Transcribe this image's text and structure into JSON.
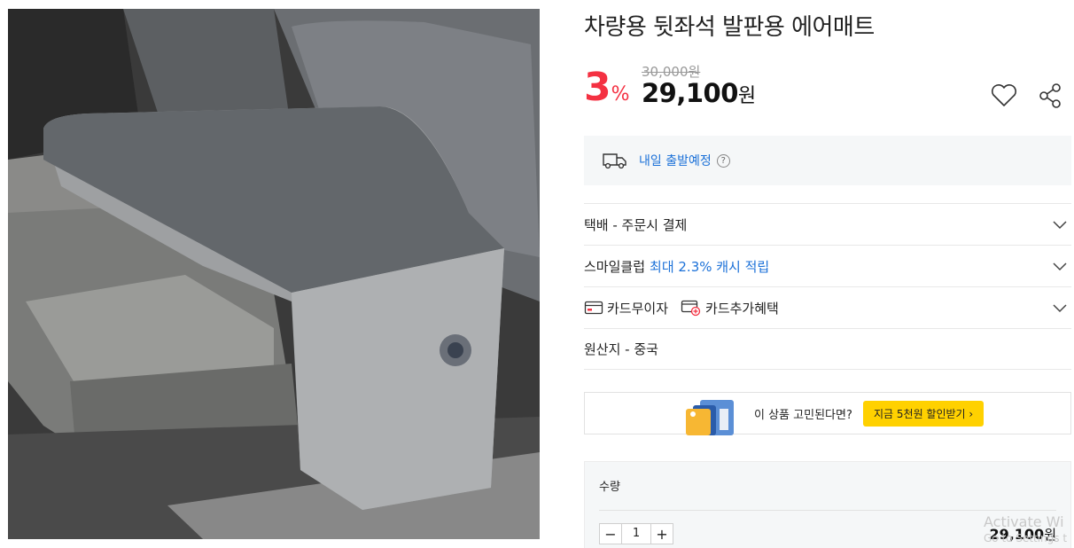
{
  "product": {
    "title": "차량용 뒷좌석 발판용 에어매트",
    "original_price": "30,000원",
    "discount_num": "3",
    "discount_pct": "%",
    "sale_price": "29,100",
    "sale_unit": "원"
  },
  "icons": {
    "wishlist": "heart-icon",
    "share": "share-icon",
    "delivery": "truck-icon",
    "help": "question-icon"
  },
  "delivery": {
    "text": "내일 출발예정",
    "help": "?"
  },
  "info_rows": {
    "shipping": "택배 - 주문시 결제",
    "smile_prefix": "스마일클럽",
    "smile_highlight": "최대 2.3% 캐시 적립",
    "card_installment": "카드무이자",
    "card_benefit": "카드추가혜택",
    "origin": "원산지 - 중국"
  },
  "promo": {
    "question": "이 상품 고민된다면?",
    "cta": "지금 5천원 할인받기 ›"
  },
  "quantity": {
    "label": "수량",
    "minus": "−",
    "value": "1",
    "plus": "+",
    "total": "29,100",
    "total_unit": "원"
  },
  "watermark": {
    "line1": "Activate Wi",
    "line2": "Go to Settings t"
  },
  "colors": {
    "discount": "#f43142",
    "link": "#1c71d8",
    "cta": "#ffd100",
    "panel": "#f5f7f8"
  }
}
